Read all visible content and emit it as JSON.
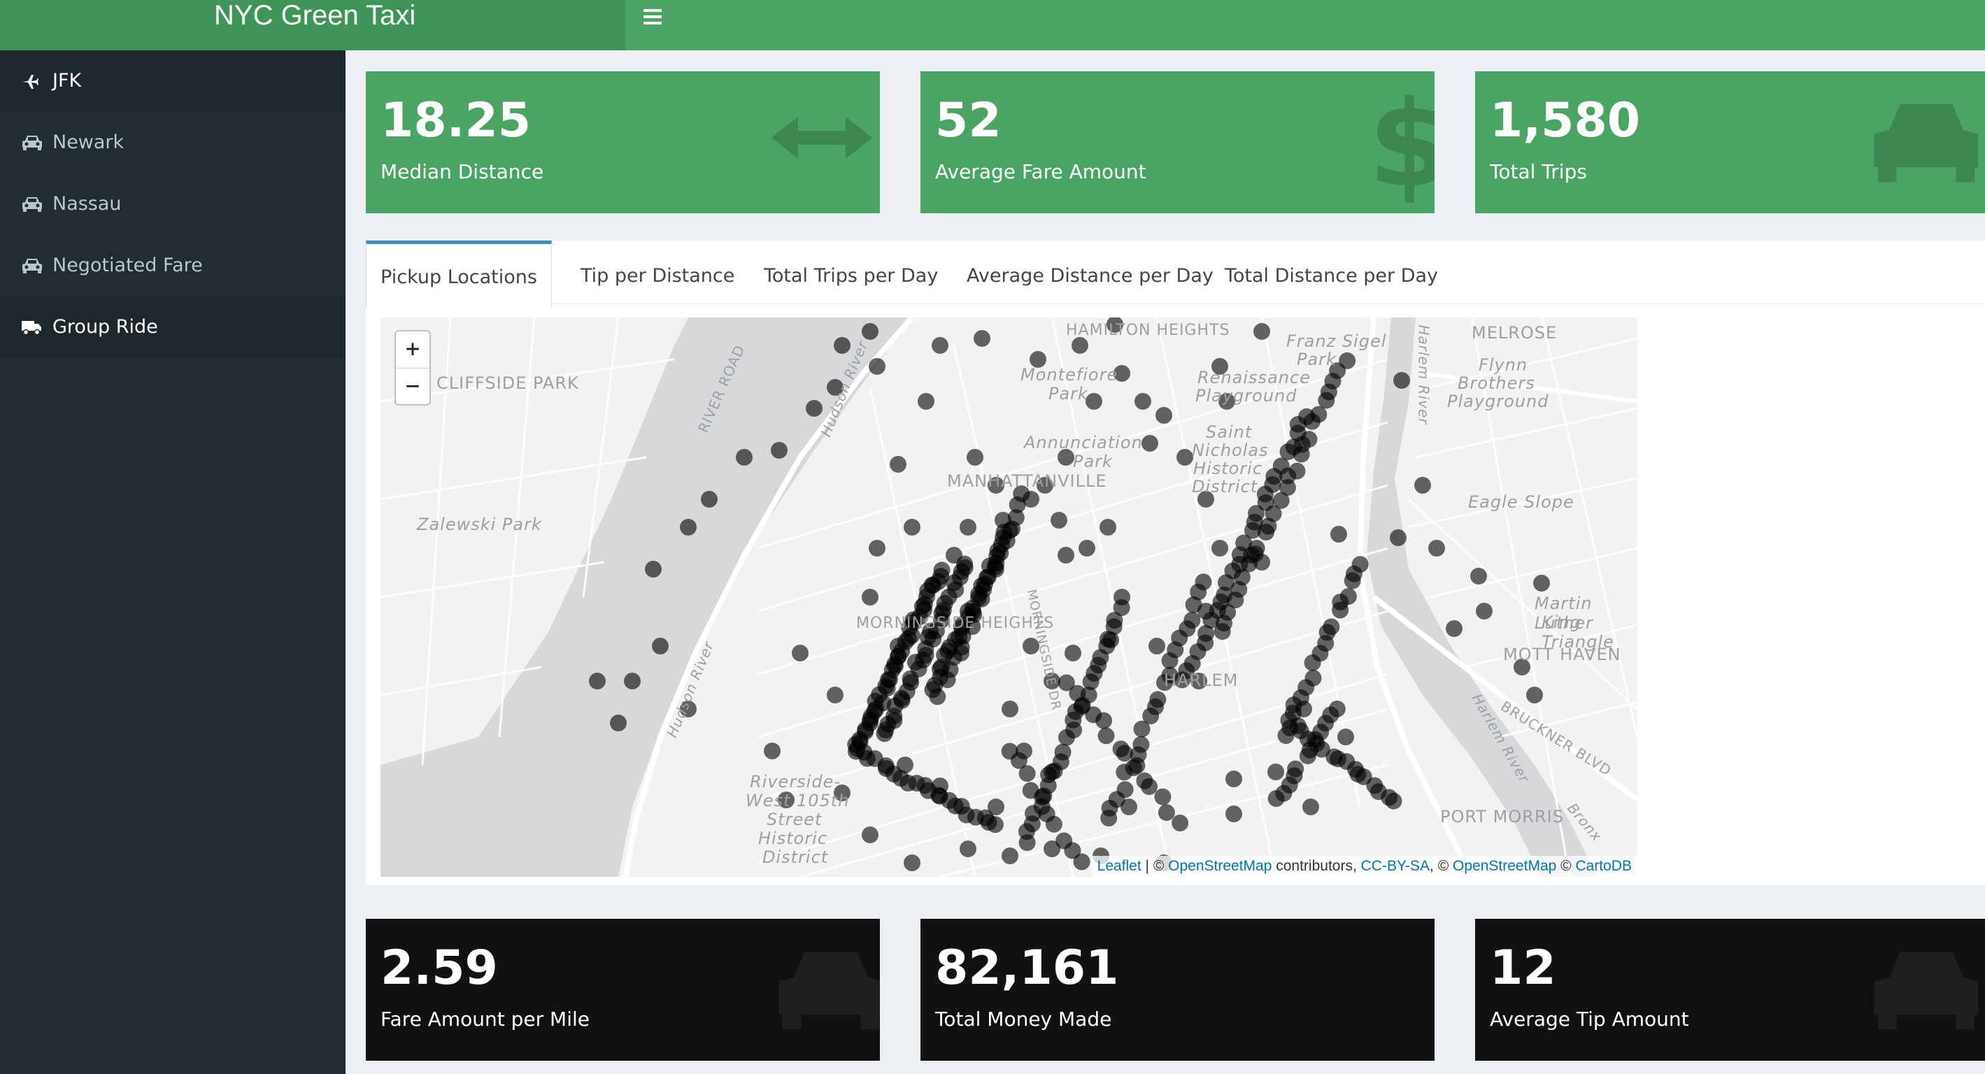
{
  "app": {
    "title": "NYC Green Taxi",
    "menu_icon": "hamburger-icon"
  },
  "sidebar": {
    "items": [
      {
        "label": "JFK",
        "icon": "plane-icon"
      },
      {
        "label": "Newark",
        "icon": "car-icon"
      },
      {
        "label": "Nassau",
        "icon": "car-icon"
      },
      {
        "label": "Negotiated Fare",
        "icon": "car-icon"
      },
      {
        "label": "Group Ride",
        "icon": "truck-icon"
      }
    ]
  },
  "top_boxes": [
    {
      "value": "18.25",
      "label": "Median Distance",
      "icon": "arrows-h-icon",
      "color": "#4aa564"
    },
    {
      "value": "52",
      "label": "Average Fare Amount",
      "icon": "dollar-icon",
      "color": "#4aa564"
    },
    {
      "value": "1,580",
      "label": "Total Trips",
      "icon": "car-icon",
      "color": "#4aa564"
    }
  ],
  "tabs": [
    {
      "label": "Pickup Locations",
      "active": true
    },
    {
      "label": "Tip per Distance"
    },
    {
      "label": "Total Trips per Day"
    },
    {
      "label": "Average Distance per Day"
    },
    {
      "label": "Total Distance per Day"
    }
  ],
  "map": {
    "zoom_in": "+",
    "zoom_out": "−",
    "attribution": {
      "leaflet": "Leaflet",
      "sep": " | © ",
      "osm": "OpenStreetMap",
      "contrib": " contributors, ",
      "ccbysa": "CC-BY-SA",
      "sep2": ", © ",
      "osm2": "OpenStreetMap",
      "sep3": " © ",
      "carto": "CartoDB"
    },
    "labels": {
      "cliffside": "CLIFFSIDE PARK",
      "zalewski": "Zalewski Park",
      "manhattanville": "MANHATTANVILLE",
      "annunciation1": "Annunciation",
      "annunciation2": "Park",
      "montefiore1": "Montefiore",
      "montefiore2": "Park",
      "mott": "MOTT HAVEN",
      "port": "PORT MORRIS",
      "eagle": "Eagle Slope",
      "flynn1": "Flynn",
      "flynn2": "Brothers",
      "flynn3": "Playground",
      "franz1": "Franz Sigel",
      "franz2": "Park",
      "mlk1": "Martin Luther",
      "mlk2": "King Triangle",
      "riverside1": "Riverside-",
      "riverside2": "West 105th",
      "riverside3": "Street",
      "riverside4": "Historic",
      "riverside5": "District",
      "hudson1": "Hudson River",
      "hudson2": "Hudson River",
      "harlem_river1": "Harlem River",
      "harlem_river2": "Harlem River",
      "river_road": "RIVER ROAD",
      "bruckner": "BRUCKNER BLVD",
      "bronx": "Bronx",
      "harlem": "HARLEM",
      "morning": "MORNINGSIDE DR",
      "morn_h": "MORNINGSIDE HEIGHTS",
      "melrose": "MELROSE",
      "stnic1": "Saint",
      "stnic2": "Nicholas",
      "stnic3": "Historic",
      "stnic4": "District",
      "renaissance1": "Renaissance",
      "renaissance2": "Playground",
      "hamilton": "HAMILTON HEIGHTS"
    }
  },
  "bottom_boxes": [
    {
      "value": "2.59",
      "label": "Fare Amount per Mile",
      "icon": "car-icon",
      "color": "#111111"
    },
    {
      "value": "82,161",
      "label": "Total Money Made",
      "icon": "money-icon",
      "color": "#111111"
    },
    {
      "value": "12",
      "label": "Average Tip Amount",
      "icon": "car-icon",
      "color": "#111111"
    }
  ]
}
